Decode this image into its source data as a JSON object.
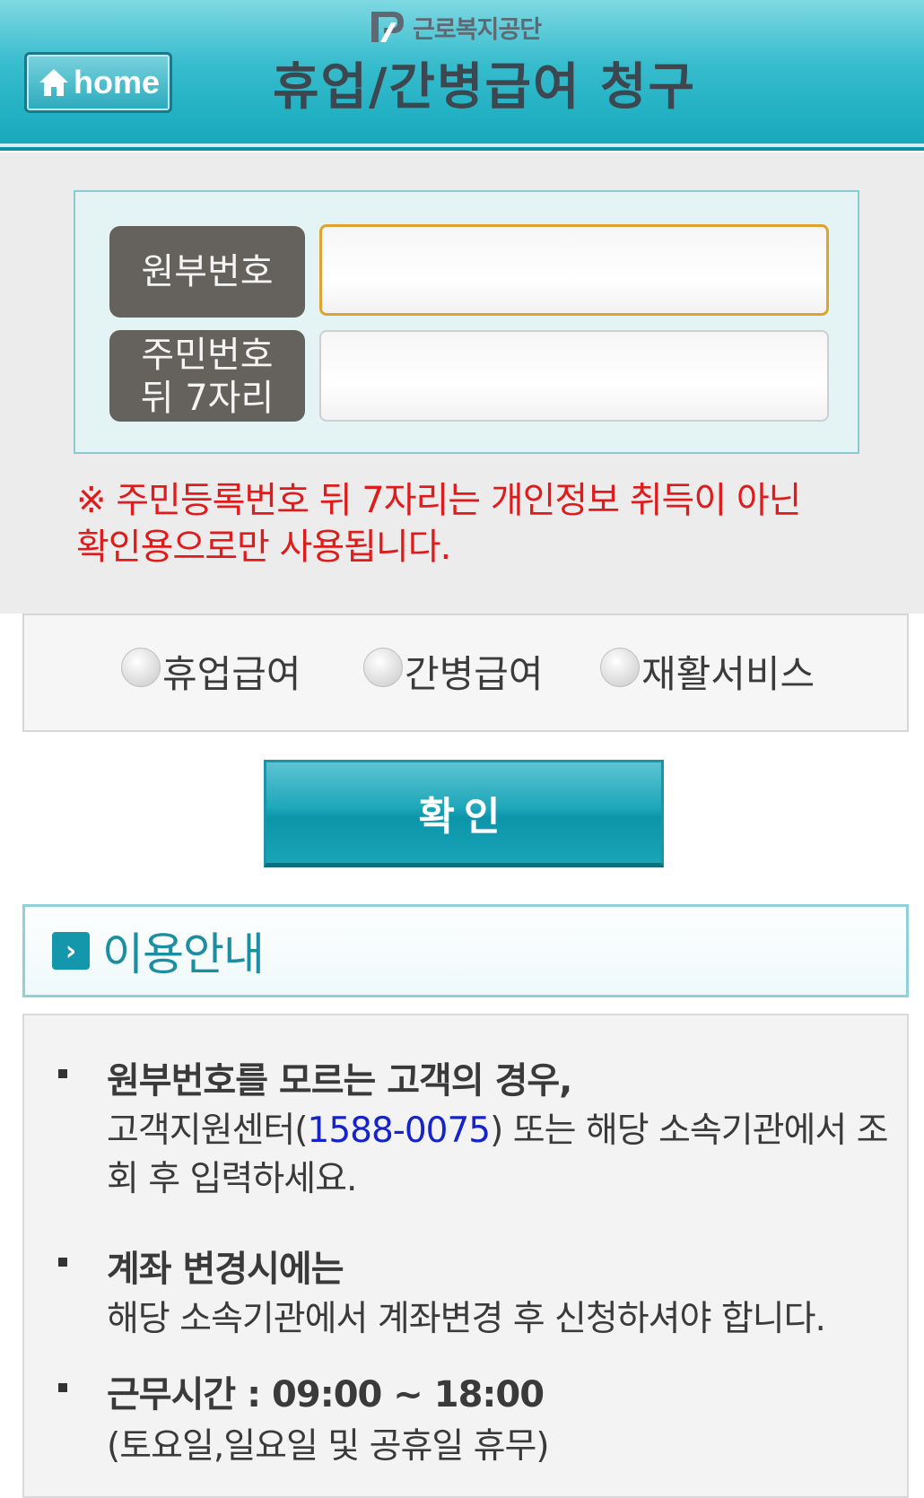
{
  "header": {
    "logo_text": "근로복지공단",
    "home_label": "home",
    "title": "휴업/간병급여 청구"
  },
  "form": {
    "field1_label": "원부번호",
    "field1_value": "",
    "field2_label_line1": "주민번호",
    "field2_label_line2": "뒤 7자리",
    "field2_value": "",
    "notice_line1": "※ 주민등록번호 뒤 7자리는 개인정보 취득이 아닌",
    "notice_line2": "확인용으로만 사용됩니다."
  },
  "radio_options": [
    "휴업급여",
    "간병급여",
    "재활서비스"
  ],
  "confirm_label": "확인",
  "info": {
    "title": "이용안내",
    "item1_head": "원부번호를 모르는 고객의 경우,",
    "item1_text_a": "고객지원센터(",
    "item1_phone": "1588-0075",
    "item1_text_b": ") 또는 해당 소속기관에서 조회 후 입력하세요.",
    "item2_head": "계좌 변경시에는",
    "item2_text": "해당 소속기관에서 계좌변경 후 신청하셔야 합니다.",
    "item3_head": "근무시간 : 09:00 ~ 18:00",
    "item3_text": "(토요일,일요일 및 공휴일 휴무)"
  },
  "colors": {
    "header_teal": "#16a9bd",
    "notice_red": "#e01b1b",
    "phone_blue": "#1523c8",
    "input_focus": "#e0a331"
  }
}
